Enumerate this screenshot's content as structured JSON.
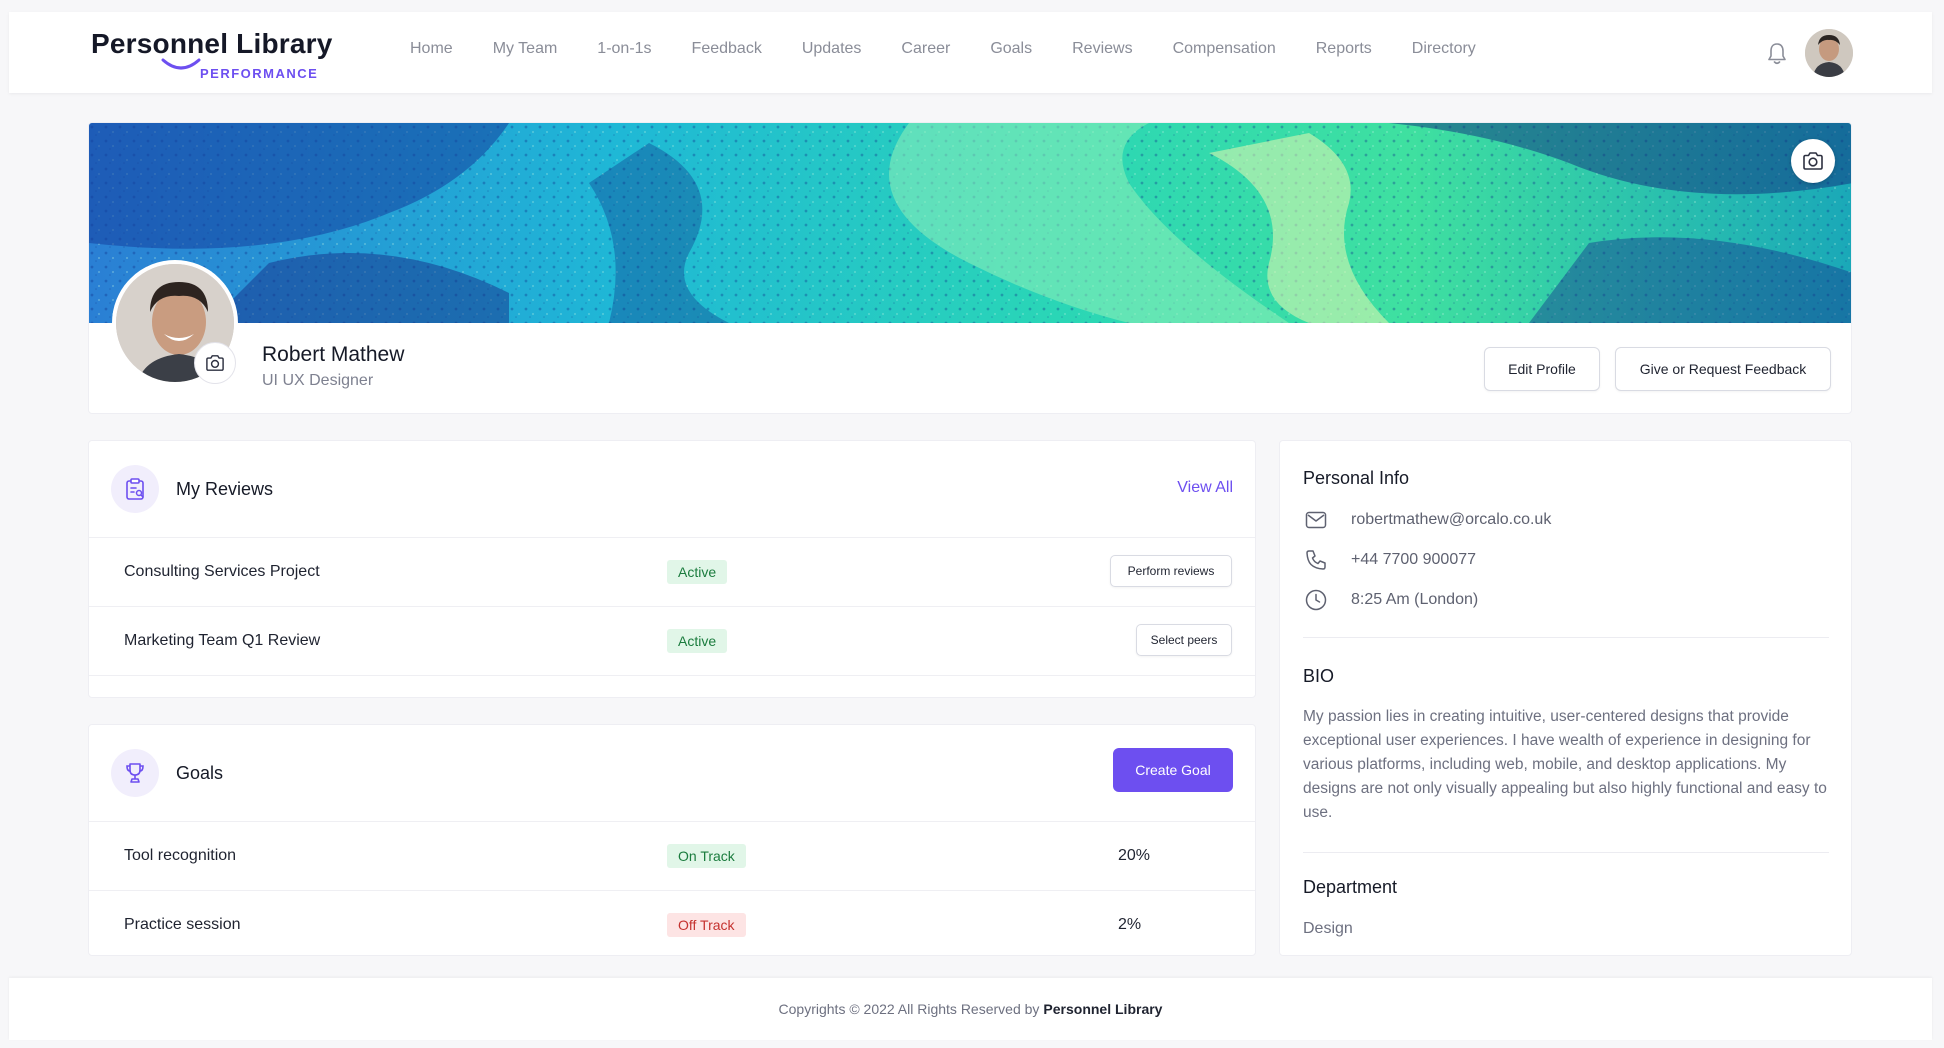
{
  "brand": {
    "name": "Personnel Library",
    "sub": "PERFORMANCE",
    "accent": "#6d4ff0"
  },
  "nav": [
    "Home",
    "My Team",
    "1-on-1s",
    "Feedback",
    "Updates",
    "Career",
    "Goals",
    "Reviews",
    "Compensation",
    "Reports",
    "Directory"
  ],
  "profile": {
    "name": "Robert Mathew",
    "role": "UI UX Designer",
    "edit_label": "Edit Profile",
    "feedback_label": "Give or Request Feedback"
  },
  "reviews": {
    "title": "My Reviews",
    "view_all": "View All",
    "rows": [
      {
        "label": "Consulting Services Project",
        "status": "Active",
        "action": "Perform reviews"
      },
      {
        "label": "Marketing Team Q1 Review",
        "status": "Active",
        "action": "Select peers"
      }
    ]
  },
  "goals": {
    "title": "Goals",
    "create_label": "Create Goal",
    "rows": [
      {
        "label": "Tool recognition",
        "status": "On Track",
        "progress": "20%"
      },
      {
        "label": "Practice session",
        "status": "Off Track",
        "progress": "2%"
      }
    ]
  },
  "personal": {
    "title": "Personal Info",
    "email": "robertmathew@orcalo.co.uk",
    "phone": "+44 7700 900077",
    "time": "8:25 Am (London)",
    "bio_title": "BIO",
    "bio": "My passion lies in creating intuitive, user-centered designs that provide exceptional user experiences. I have wealth of experience in designing for various platforms, including web, mobile, and desktop applications. My designs are not only visually appealing but also highly functional and easy to use.",
    "department_title": "Department",
    "department": "Design"
  },
  "footer": {
    "text": "Copyrights © 2022 All Rights Reserved by",
    "brand": "Personnel Library"
  },
  "icons": [
    "bell-icon",
    "camera-icon",
    "reviews-clipboard-icon",
    "trophy-icon",
    "mail-icon",
    "phone-icon",
    "clock-icon"
  ]
}
